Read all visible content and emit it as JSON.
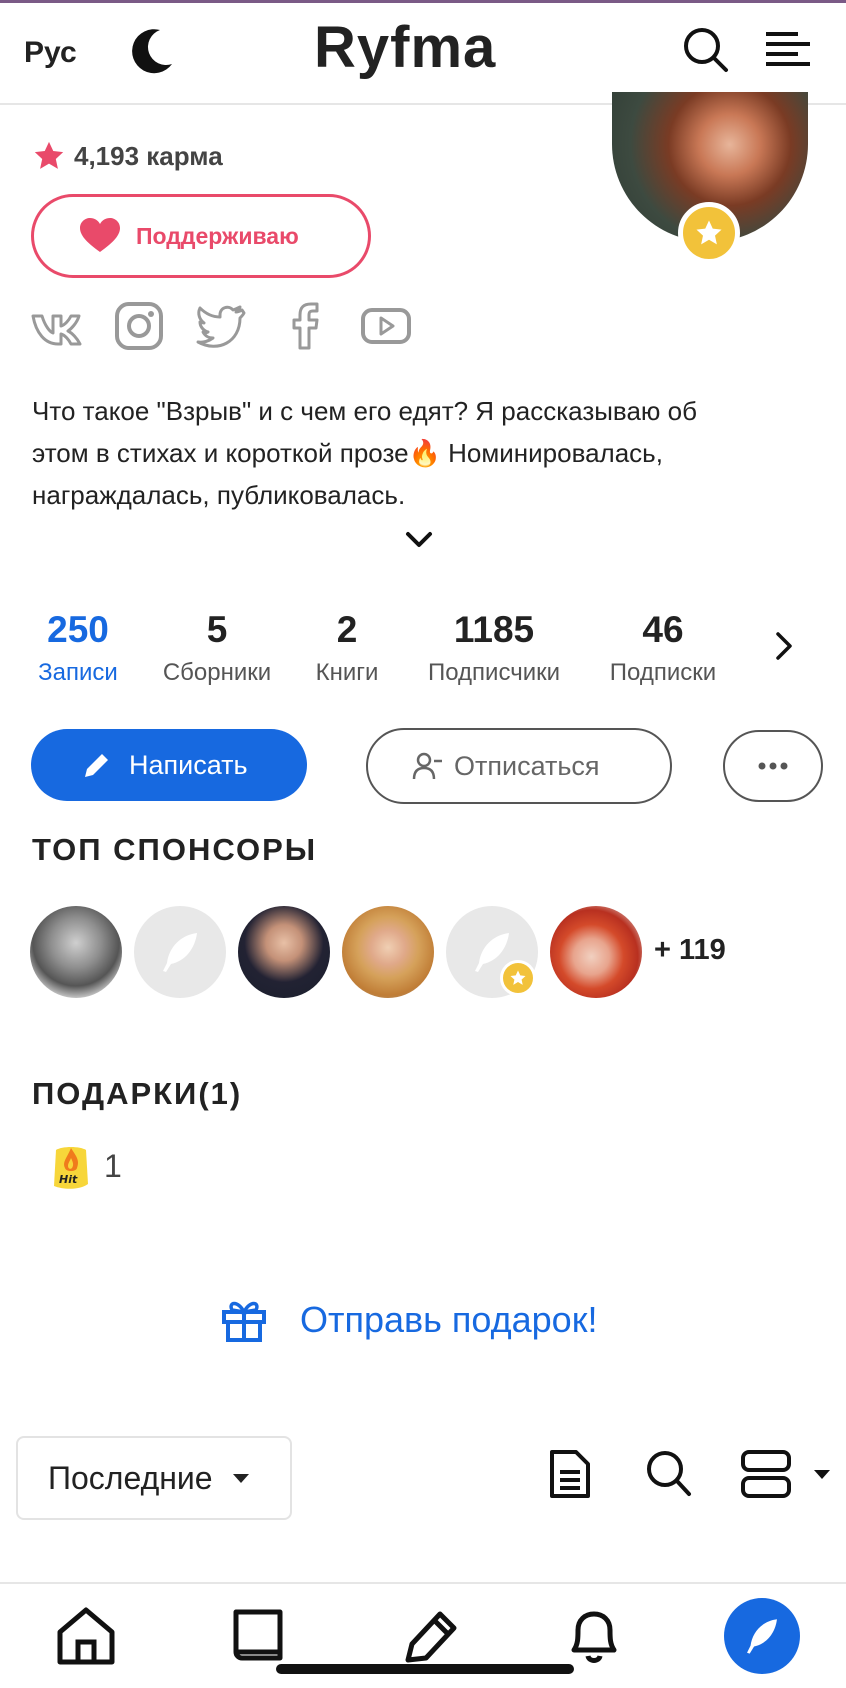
{
  "header": {
    "lang": "Рус",
    "logo": "Ryfma"
  },
  "profile": {
    "karma": "4,193 карма",
    "support_label": "Поддерживаю",
    "bio": "Что такое \"Взрыв\" и с чем его едят? Я рассказываю об этом в стихах и короткой прозе🔥 Номинировалась, награждалась, публиковалась."
  },
  "stats": [
    {
      "value": "250",
      "label": "Записи"
    },
    {
      "value": "5",
      "label": "Сборники"
    },
    {
      "value": "2",
      "label": "Книги"
    },
    {
      "value": "1185",
      "label": "Подписчики"
    },
    {
      "value": "46",
      "label": "Подписки"
    }
  ],
  "actions": {
    "write": "Написать",
    "unsubscribe": "Отписаться"
  },
  "sponsors": {
    "title": "ТОП СПОНСОРЫ",
    "more": "+ 119"
  },
  "gifts": {
    "title": "ПОДАРКИ(1)",
    "count": "1",
    "send": "Отправь подарок!"
  },
  "feed": {
    "sort": "Последние"
  },
  "colors": {
    "accent": "#1769e0",
    "support": "#e94a6a",
    "badge": "#f2c23a"
  },
  "icons": [
    "moon-icon",
    "search-icon",
    "menu-icon",
    "star-icon",
    "heart-icon",
    "vk-icon",
    "instagram-icon",
    "twitter-icon",
    "facebook-icon",
    "youtube-icon",
    "pencil-icon",
    "user-minus-icon",
    "gift-icon",
    "document-icon",
    "layout-icon",
    "home-icon",
    "book-icon",
    "write-icon",
    "bell-icon",
    "feather-icon"
  ]
}
